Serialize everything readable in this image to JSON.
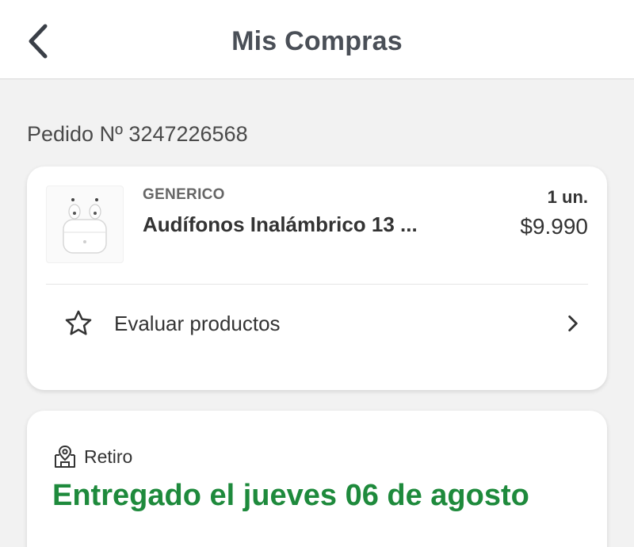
{
  "header": {
    "title": "Mis Compras",
    "back_icon": "chevron-left-icon"
  },
  "order": {
    "label": "Pedido Nº 3247226568"
  },
  "product": {
    "brand": "GENERICO",
    "name": "Audífonos Inalámbrico 13 ...",
    "quantity": "1 un.",
    "price": "$9.990",
    "image_icon": "earbuds-image"
  },
  "evaluate": {
    "label": "Evaluar productos",
    "icon": "star-icon",
    "chevron": "chevron-right-icon"
  },
  "delivery": {
    "method": "Retiro",
    "method_icon": "store-pin-icon",
    "status": "Entregado el jueves 06 de agosto",
    "status_color": "#1e8a3c"
  }
}
